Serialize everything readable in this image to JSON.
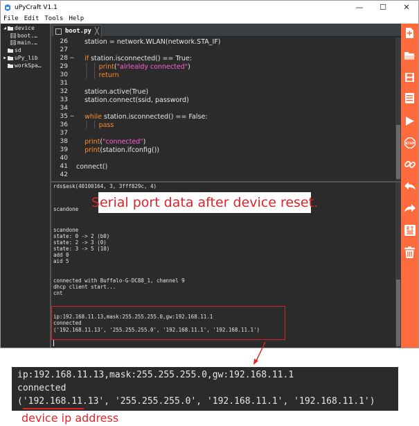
{
  "window": {
    "title": "uPyCraft V1.1",
    "minimize": "—",
    "maximize": "☐",
    "close": "✕"
  },
  "menu": [
    "File",
    "Edit",
    "Tools",
    "Help"
  ],
  "tree": {
    "items": [
      {
        "label": "device",
        "arrow": "◢",
        "type": "folder"
      },
      {
        "label": "boot.…",
        "arrow": "",
        "type": "file"
      },
      {
        "label": "main.…",
        "arrow": "",
        "type": "file"
      },
      {
        "label": "sd",
        "arrow": "",
        "type": "folder"
      },
      {
        "label": "uPy_lib",
        "arrow": "▶",
        "type": "folder"
      },
      {
        "label": "workSpa…",
        "arrow": "",
        "type": "folder"
      }
    ]
  },
  "editor": {
    "tab_label": "boot.py",
    "tab_close": "╳",
    "lines": [
      {
        "n": "26",
        "fold": "",
        "segs": [
          [
            "txt",
            "    station = network.WLAN(network.STA_IF)"
          ]
        ]
      },
      {
        "n": "27",
        "fold": "",
        "segs": [
          [
            "txt",
            ""
          ]
        ]
      },
      {
        "n": "28",
        "fold": "−",
        "segs": [
          [
            "txt",
            "    "
          ],
          [
            "kw",
            "if"
          ],
          [
            "txt",
            " station.isconnected() == True:"
          ]
        ]
      },
      {
        "n": "29",
        "fold": "",
        "segs": [
          [
            "guide",
            "    │  │ "
          ],
          [
            "kw",
            "print"
          ],
          [
            "txt",
            "("
          ],
          [
            "str",
            "\"alrlealdy connected\""
          ],
          [
            "txt",
            ")"
          ]
        ]
      },
      {
        "n": "30",
        "fold": "",
        "segs": [
          [
            "guide",
            "    │  │ "
          ],
          [
            "kw",
            "return"
          ]
        ]
      },
      {
        "n": "31",
        "fold": "",
        "segs": [
          [
            "txt",
            ""
          ]
        ]
      },
      {
        "n": "32",
        "fold": "",
        "segs": [
          [
            "txt",
            "    station.active(True)"
          ]
        ]
      },
      {
        "n": "33",
        "fold": "",
        "segs": [
          [
            "txt",
            "    station.connect(ssid, password)"
          ]
        ]
      },
      {
        "n": "34",
        "fold": "",
        "segs": [
          [
            "txt",
            ""
          ]
        ]
      },
      {
        "n": "35",
        "fold": "−",
        "segs": [
          [
            "txt",
            "    "
          ],
          [
            "kw",
            "while"
          ],
          [
            "txt",
            " station.isconnected() == False:"
          ]
        ]
      },
      {
        "n": "36",
        "fold": "",
        "segs": [
          [
            "guide",
            "    │  │ "
          ],
          [
            "kw",
            "pass"
          ]
        ]
      },
      {
        "n": "37",
        "fold": "",
        "segs": [
          [
            "txt",
            ""
          ]
        ]
      },
      {
        "n": "38",
        "fold": "",
        "segs": [
          [
            "txt",
            "    "
          ],
          [
            "kw",
            "print"
          ],
          [
            "txt",
            "("
          ],
          [
            "str",
            "\"connected\""
          ],
          [
            "txt",
            ")"
          ]
        ]
      },
      {
        "n": "39",
        "fold": "",
        "segs": [
          [
            "txt",
            "    "
          ],
          [
            "kw",
            "print"
          ],
          [
            "txt",
            "(station.ifconfig())"
          ]
        ]
      },
      {
        "n": "40",
        "fold": "",
        "segs": [
          [
            "txt",
            ""
          ]
        ]
      },
      {
        "n": "41",
        "fold": "",
        "segs": [
          [
            "txt",
            "connect()"
          ]
        ]
      },
      {
        "n": "42",
        "fold": "",
        "segs": [
          [
            "txt",
            ""
          ]
        ]
      }
    ]
  },
  "terminal": {
    "lines": [
      "rds$ask(40100164, 3, 3fff829c, 4)",
      "",
      "",
      "scandone",
      "",
      "",
      "",
      "scandone",
      "state: 0 -> 2 (b0)",
      "state: 2 -> 3 (0)",
      "state: 3 -> 5 (10)",
      "add 0",
      "aid 5",
      "",
      "connected with Buffalo-G-DC88_1, channel 9",
      "dhcp client start...",
      "cnt",
      "",
      "",
      "ip:192.168.11.13,mask:255.255.255.0,gw:192.168.11.1",
      "connected",
      "('192.168.11.13', '255.255.255.0', '192.168.11.1', '192.168.11.1')"
    ]
  },
  "annotation": {
    "text": "Serial port data after device reset.",
    "color": "#e0242a"
  },
  "zoom": {
    "lines": [
      "ip:192.168.11.13,mask:255.255.255.0,gw:192.168.11.1",
      "connected",
      "('192.168.11.13', '255.255.255.0', '192.168.11.1', '192.168.11.1')"
    ],
    "label": "device ip address"
  },
  "toolbar": {
    "accent": "#ff6b3d",
    "tools": [
      "new-file-icon",
      "open-folder-icon",
      "save-icon",
      "download-icon",
      "run-icon",
      "stop-icon",
      "connect-icon",
      "undo-icon",
      "redo-icon",
      "syntax-check-icon",
      "clear-icon"
    ]
  }
}
